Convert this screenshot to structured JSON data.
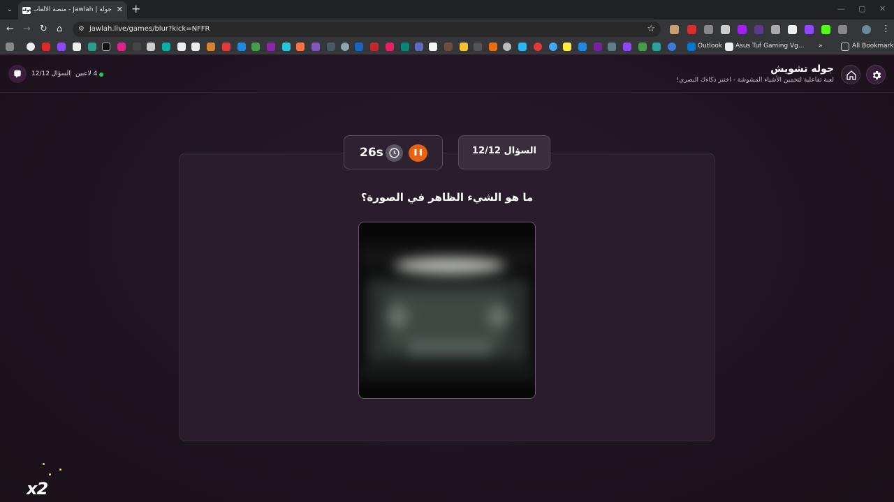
{
  "browser": {
    "tab_title": "جولة | Jawlah - منصة الألعاب الت...",
    "tab_favicon_text": "جولة",
    "url": "jawlah.live/games/blur?kick=NFFR",
    "bookmarks": {
      "outlook": "Outlook",
      "asus": "Asus Tuf Gaming Vg...",
      "all": "All Bookmarks"
    }
  },
  "header": {
    "title": "جوله تشويش",
    "subtitle": "لعبة تفاعلية لتخمين الأشياء المشوشة - اختبر ذكاءك البصري!",
    "question_count": "السؤال 12/12",
    "players": "4 لاعبين"
  },
  "game": {
    "timer": "26s",
    "question_badge": "السؤال 12/12",
    "question": "ما هو الشيء الظاهر في الصورة؟",
    "multiplier": "x2"
  },
  "colors": {
    "accent": "#e8620f",
    "online": "#22c55e",
    "bg": "#1f1521"
  },
  "icons": [
    "settings-icon",
    "home-icon",
    "logo-icon",
    "clock-icon",
    "pause-icon"
  ]
}
